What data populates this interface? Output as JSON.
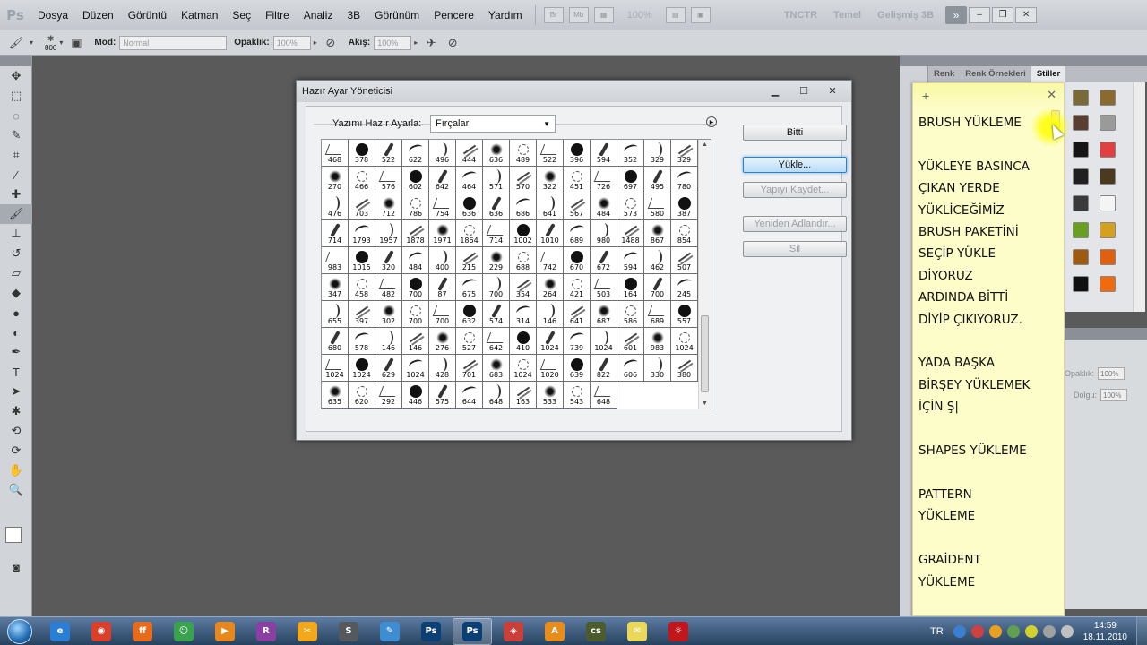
{
  "menubar": {
    "logo": "Ps",
    "items": [
      "Dosya",
      "Düzen",
      "Görüntü",
      "Katman",
      "Seç",
      "Filtre",
      "Analiz",
      "3B",
      "Görünüm",
      "Pencere",
      "Yardım"
    ],
    "mini1": "Br",
    "mini2": "Mb",
    "zoom": "100%",
    "workspaces": [
      "TNCTR",
      "Temel",
      "Gelişmiş 3B"
    ],
    "chevron": "»"
  },
  "options": {
    "brush_size": "800",
    "mode_label": "Mod:",
    "mode_value": "Normal",
    "opacity_label": "Opaklık:",
    "opacity_value": "100%",
    "flow_label": "Akış:",
    "flow_value": "100%"
  },
  "dialog": {
    "title": "Hazır Ayar Yöneticisi",
    "preset_type_label": "Yazımı Hazır Ayarla:",
    "preset_type_value": "Fırçalar",
    "brush_sizes": [
      "468",
      "378",
      "522",
      "622",
      "496",
      "444",
      "636",
      "489",
      "522",
      "396",
      "594",
      "352",
      "329",
      "329",
      "270",
      "466",
      "576",
      "602",
      "642",
      "464",
      "571",
      "570",
      "322",
      "451",
      "726",
      "697",
      "495",
      "780",
      "476",
      "703",
      "712",
      "786",
      "754",
      "636",
      "636",
      "686",
      "641",
      "567",
      "484",
      "573",
      "580",
      "387",
      "714",
      "1793",
      "1957",
      "1878",
      "1971",
      "1864",
      "714",
      "1002",
      "1010",
      "689",
      "980",
      "1488",
      "867",
      "854",
      "983",
      "1015",
      "320",
      "484",
      "400",
      "215",
      "229",
      "688",
      "742",
      "670",
      "672",
      "594",
      "462",
      "507",
      "347",
      "458",
      "482",
      "700",
      "87",
      "675",
      "700",
      "354",
      "264",
      "421",
      "503",
      "164",
      "700",
      "245",
      "655",
      "397",
      "302",
      "700",
      "700",
      "632",
      "574",
      "314",
      "146",
      "641",
      "687",
      "586",
      "689",
      "557",
      "680",
      "578",
      "146",
      "146",
      "276",
      "527",
      "642",
      "410",
      "1024",
      "739",
      "1024",
      "601",
      "983",
      "1024",
      "1024",
      "1024",
      "629",
      "1024",
      "428",
      "701",
      "683",
      "1024",
      "1020",
      "639",
      "822",
      "606",
      "330",
      "380",
      "635",
      "620",
      "292",
      "446",
      "575",
      "644",
      "648",
      "163",
      "533",
      "543",
      "648"
    ],
    "buttons": {
      "done": "Bitti",
      "load": "Yükle...",
      "save": "Yapıyı Kaydet...",
      "rename": "Yeniden Adlandır...",
      "delete": "Sil"
    }
  },
  "right_panel": {
    "tabs": [
      "Renk",
      "Renk Örnekleri",
      "Stiller"
    ],
    "opacity_label": "Opaklık:",
    "opacity_value": "100%",
    "fill_label": "Dolgu:",
    "fill_value": "100%"
  },
  "sticky_note": {
    "text": "BRUSH YÜKLEME\n\nYÜKLEYE BASINCA\nÇIKAN YERDE\nYÜKLİCEĞİMİZ\nBRUSH PAKETİNİ\nSEÇİP YÜKLE\nDİYORUZ\nARDINDA BİTTİ\nDİYİP ÇIKIYORUZ.\n\nYADA BAŞKA\nBİRŞEY YÜKLEMEK\nİÇİN Ş|\n\nSHAPES YÜKLEME\n\nPATTERN\nYÜKLEME\n\nGRAİDENT\nYÜKLEME"
  },
  "taskbar": {
    "apps": [
      {
        "name": "ie",
        "label": "e",
        "color": "#2a7fd4"
      },
      {
        "name": "chrome",
        "label": "◉",
        "color": "#d9402b"
      },
      {
        "name": "firefox",
        "label": "ff",
        "color": "#e66b1c"
      },
      {
        "name": "messenger",
        "label": "☺",
        "color": "#39a24f"
      },
      {
        "name": "media-player",
        "label": "▶",
        "color": "#e7881e"
      },
      {
        "name": "winrar",
        "label": "R",
        "color": "#8a3fa3"
      },
      {
        "name": "tool-app",
        "label": "✂",
        "color": "#f1a81c"
      },
      {
        "name": "steam",
        "label": "S",
        "color": "#55595e"
      },
      {
        "name": "paint",
        "label": "✎",
        "color": "#3e8dd0"
      },
      {
        "name": "photoshop",
        "label": "Ps",
        "color": "#0c3f73"
      },
      {
        "name": "photoshop-2",
        "label": "Ps",
        "color": "#0c3f73"
      },
      {
        "name": "chrome-shortcut",
        "label": "◈",
        "color": "#c93f39"
      },
      {
        "name": "avast",
        "label": "A",
        "color": "#e88c1c"
      },
      {
        "name": "counter-strike",
        "label": "cs",
        "color": "#4d5c2f"
      },
      {
        "name": "sticky-notes",
        "label": "✉",
        "color": "#e9d85a"
      },
      {
        "name": "flag-app",
        "label": "☼",
        "color": "#c0171c"
      }
    ],
    "language": "TR",
    "time": "14:59",
    "date": "18.11.2010"
  }
}
